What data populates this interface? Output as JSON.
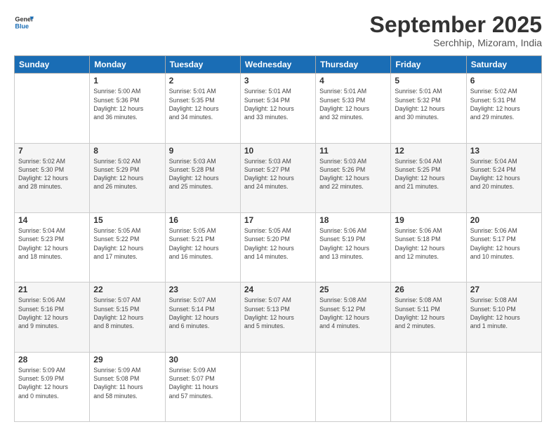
{
  "header": {
    "logo_line1": "General",
    "logo_line2": "Blue",
    "month_title": "September 2025",
    "subtitle": "Serchhip, Mizoram, India"
  },
  "weekdays": [
    "Sunday",
    "Monday",
    "Tuesday",
    "Wednesday",
    "Thursday",
    "Friday",
    "Saturday"
  ],
  "weeks": [
    [
      {
        "day": "",
        "info": ""
      },
      {
        "day": "1",
        "info": "Sunrise: 5:00 AM\nSunset: 5:36 PM\nDaylight: 12 hours\nand 36 minutes."
      },
      {
        "day": "2",
        "info": "Sunrise: 5:01 AM\nSunset: 5:35 PM\nDaylight: 12 hours\nand 34 minutes."
      },
      {
        "day": "3",
        "info": "Sunrise: 5:01 AM\nSunset: 5:34 PM\nDaylight: 12 hours\nand 33 minutes."
      },
      {
        "day": "4",
        "info": "Sunrise: 5:01 AM\nSunset: 5:33 PM\nDaylight: 12 hours\nand 32 minutes."
      },
      {
        "day": "5",
        "info": "Sunrise: 5:01 AM\nSunset: 5:32 PM\nDaylight: 12 hours\nand 30 minutes."
      },
      {
        "day": "6",
        "info": "Sunrise: 5:02 AM\nSunset: 5:31 PM\nDaylight: 12 hours\nand 29 minutes."
      }
    ],
    [
      {
        "day": "7",
        "info": "Sunrise: 5:02 AM\nSunset: 5:30 PM\nDaylight: 12 hours\nand 28 minutes."
      },
      {
        "day": "8",
        "info": "Sunrise: 5:02 AM\nSunset: 5:29 PM\nDaylight: 12 hours\nand 26 minutes."
      },
      {
        "day": "9",
        "info": "Sunrise: 5:03 AM\nSunset: 5:28 PM\nDaylight: 12 hours\nand 25 minutes."
      },
      {
        "day": "10",
        "info": "Sunrise: 5:03 AM\nSunset: 5:27 PM\nDaylight: 12 hours\nand 24 minutes."
      },
      {
        "day": "11",
        "info": "Sunrise: 5:03 AM\nSunset: 5:26 PM\nDaylight: 12 hours\nand 22 minutes."
      },
      {
        "day": "12",
        "info": "Sunrise: 5:04 AM\nSunset: 5:25 PM\nDaylight: 12 hours\nand 21 minutes."
      },
      {
        "day": "13",
        "info": "Sunrise: 5:04 AM\nSunset: 5:24 PM\nDaylight: 12 hours\nand 20 minutes."
      }
    ],
    [
      {
        "day": "14",
        "info": "Sunrise: 5:04 AM\nSunset: 5:23 PM\nDaylight: 12 hours\nand 18 minutes."
      },
      {
        "day": "15",
        "info": "Sunrise: 5:05 AM\nSunset: 5:22 PM\nDaylight: 12 hours\nand 17 minutes."
      },
      {
        "day": "16",
        "info": "Sunrise: 5:05 AM\nSunset: 5:21 PM\nDaylight: 12 hours\nand 16 minutes."
      },
      {
        "day": "17",
        "info": "Sunrise: 5:05 AM\nSunset: 5:20 PM\nDaylight: 12 hours\nand 14 minutes."
      },
      {
        "day": "18",
        "info": "Sunrise: 5:06 AM\nSunset: 5:19 PM\nDaylight: 12 hours\nand 13 minutes."
      },
      {
        "day": "19",
        "info": "Sunrise: 5:06 AM\nSunset: 5:18 PM\nDaylight: 12 hours\nand 12 minutes."
      },
      {
        "day": "20",
        "info": "Sunrise: 5:06 AM\nSunset: 5:17 PM\nDaylight: 12 hours\nand 10 minutes."
      }
    ],
    [
      {
        "day": "21",
        "info": "Sunrise: 5:06 AM\nSunset: 5:16 PM\nDaylight: 12 hours\nand 9 minutes."
      },
      {
        "day": "22",
        "info": "Sunrise: 5:07 AM\nSunset: 5:15 PM\nDaylight: 12 hours\nand 8 minutes."
      },
      {
        "day": "23",
        "info": "Sunrise: 5:07 AM\nSunset: 5:14 PM\nDaylight: 12 hours\nand 6 minutes."
      },
      {
        "day": "24",
        "info": "Sunrise: 5:07 AM\nSunset: 5:13 PM\nDaylight: 12 hours\nand 5 minutes."
      },
      {
        "day": "25",
        "info": "Sunrise: 5:08 AM\nSunset: 5:12 PM\nDaylight: 12 hours\nand 4 minutes."
      },
      {
        "day": "26",
        "info": "Sunrise: 5:08 AM\nSunset: 5:11 PM\nDaylight: 12 hours\nand 2 minutes."
      },
      {
        "day": "27",
        "info": "Sunrise: 5:08 AM\nSunset: 5:10 PM\nDaylight: 12 hours\nand 1 minute."
      }
    ],
    [
      {
        "day": "28",
        "info": "Sunrise: 5:09 AM\nSunset: 5:09 PM\nDaylight: 12 hours\nand 0 minutes."
      },
      {
        "day": "29",
        "info": "Sunrise: 5:09 AM\nSunset: 5:08 PM\nDaylight: 11 hours\nand 58 minutes."
      },
      {
        "day": "30",
        "info": "Sunrise: 5:09 AM\nSunset: 5:07 PM\nDaylight: 11 hours\nand 57 minutes."
      },
      {
        "day": "",
        "info": ""
      },
      {
        "day": "",
        "info": ""
      },
      {
        "day": "",
        "info": ""
      },
      {
        "day": "",
        "info": ""
      }
    ]
  ]
}
